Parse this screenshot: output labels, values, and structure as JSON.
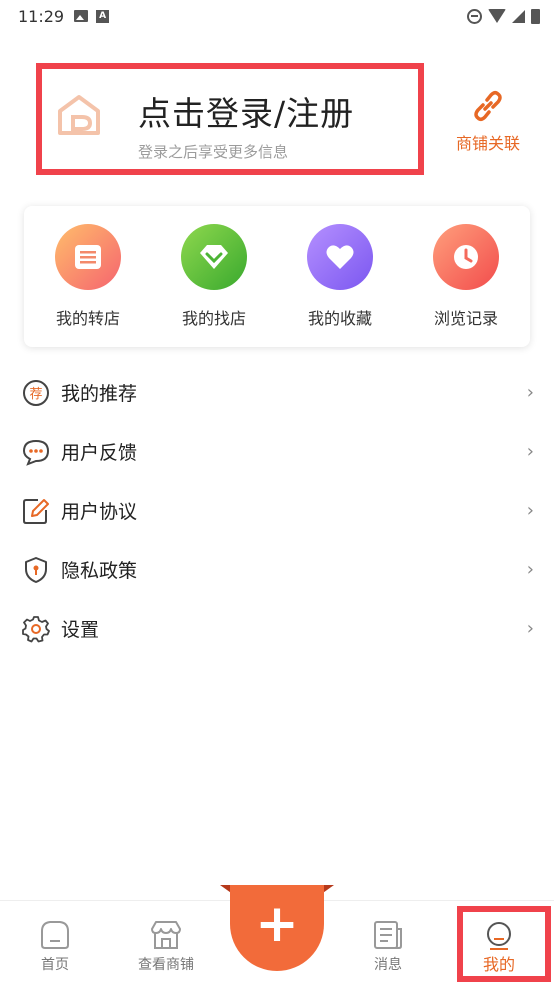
{
  "status_bar": {
    "time": "11:29"
  },
  "header": {
    "login_title": "点击登录/注册",
    "login_subtitle": "登录之后享受更多信息",
    "link_shop_label": "商铺关联"
  },
  "quick_actions": [
    {
      "label": "我的转店",
      "icon": "store-card-icon",
      "color_start": "#ffb36b",
      "color_end": "#f56a73"
    },
    {
      "label": "我的找店",
      "icon": "diamond-icon",
      "color_start": "#8ad64b",
      "color_end": "#3fae2f"
    },
    {
      "label": "我的收藏",
      "icon": "heart-icon",
      "color_start": "#b08cff",
      "color_end": "#7e5bf2"
    },
    {
      "label": "浏览记录",
      "icon": "clock-icon",
      "color_start": "#ff9a7a",
      "color_end": "#f24f4f"
    }
  ],
  "menu": [
    {
      "label": "我的推荐",
      "icon": "recommend-icon",
      "badge_char": "荐"
    },
    {
      "label": "用户反馈",
      "icon": "feedback-icon"
    },
    {
      "label": "用户协议",
      "icon": "agreement-icon"
    },
    {
      "label": "隐私政策",
      "icon": "privacy-shield-icon"
    },
    {
      "label": "设置",
      "icon": "gear-icon"
    }
  ],
  "menu_arrow": "›",
  "bottom_nav": {
    "home_label": "首页",
    "shops_label": "查看商铺",
    "add_label": "+",
    "messages_label": "消息",
    "me_label": "我的"
  },
  "colors": {
    "accent": "#e76825",
    "highlight_box": "#f0424b",
    "fab": "#f26b3a"
  }
}
